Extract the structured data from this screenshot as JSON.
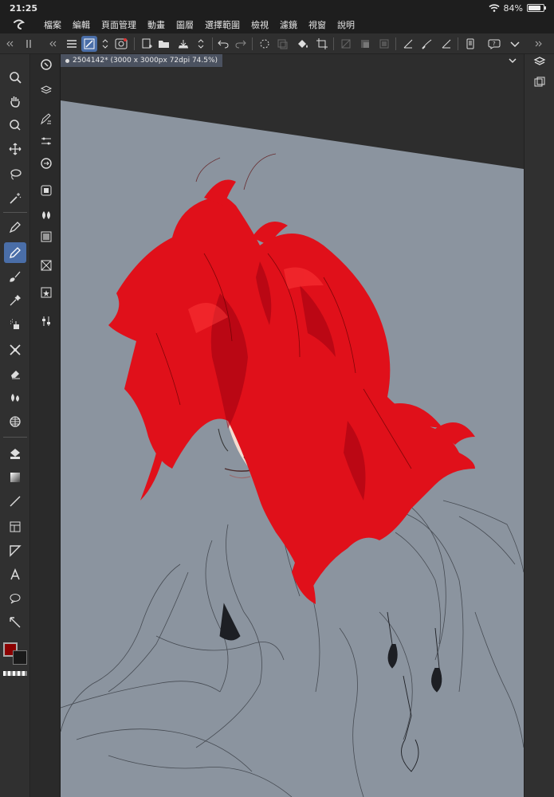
{
  "status": {
    "time": "21:25",
    "battery": "84%",
    "battery_level": 0.84
  },
  "menu": [
    "檔案",
    "編輯",
    "頁面管理",
    "動畫",
    "圖層",
    "選擇範圍",
    "檢視",
    "濾鏡",
    "視窗",
    "說明"
  ],
  "document": {
    "tab_label": "2504142* (3000 x 3000px 72dpi 74.5%)"
  },
  "colors": {
    "main_color": "#8b0000",
    "sub_color": "#1a1a1a",
    "canvas_bg": "#8b949f",
    "accent": "#4a6ea8"
  },
  "left_tools": [
    "zoom-icon",
    "hand-icon",
    "rotate-icon",
    "move-icon",
    "lasso-select-icon",
    "magic-wand-icon",
    "pen-icon",
    "pencil-icon",
    "brush-icon",
    "eyedropper-icon",
    "airbrush-icon",
    "decoration-icon",
    "eraser-icon",
    "blend-icon",
    "grid-icon",
    "fill-icon",
    "gradient-icon",
    "line-icon",
    "frame-icon",
    "ruler-icon",
    "text-icon",
    "balloon-icon",
    "correct-line-icon"
  ],
  "sub_tools": [
    "navigator-icon",
    "layer-property-icon",
    "pen-settings-icon",
    "sliders-icon",
    "color-circle-icon",
    "color-set-icon",
    "intermediate-color-icon",
    "tone-icon",
    "material-icon",
    "folder-star-icon",
    "adjust-icon"
  ],
  "right_tools": [
    "layers-icon",
    "copy-layer-icon"
  ]
}
